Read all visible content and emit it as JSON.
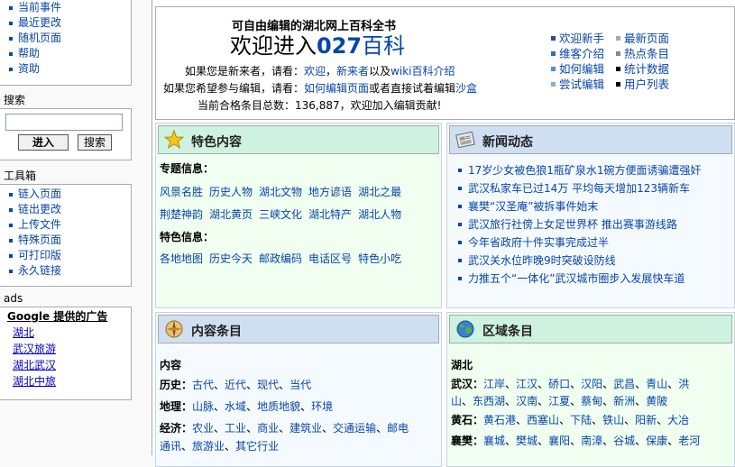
{
  "sidebar": {
    "nav_items": [
      "当前事件",
      "最近更改",
      "随机页面",
      "帮助",
      "资助"
    ],
    "search": {
      "title": "搜索",
      "go_label": "进入",
      "search_label": "搜索"
    },
    "toolbox": {
      "title": "工具箱",
      "items": [
        "链入页面",
        "链出更改",
        "上传文件",
        "特殊页面",
        "可打印版",
        "永久链接"
      ]
    },
    "ads": {
      "title": "ads",
      "provider": "Google 提供的广告",
      "links": [
        "湖北",
        "武汉旅游",
        "湖北武汉",
        "湖北中旅"
      ]
    }
  },
  "banner": {
    "tagline": "可自由编辑的湖北网上百科全书",
    "welcome_prefix": "欢迎进入",
    "welcome_num": "027",
    "welcome_suffix": "百科",
    "line1_prefix": "如果您是新来者，请看：",
    "line1_link1": "欢迎",
    "line1_mid": "，",
    "line1_link2": "新来者",
    "line1_mid2": "以及",
    "line1_link3": "wiki百科介绍",
    "line2_prefix": "如果您希望参与编辑，请看：",
    "line2_link1": "如何编辑页面",
    "line2_mid": "或者直接试着编辑",
    "line2_link2": "沙盒",
    "line3_prefix": "当前合格条目总数：",
    "line3_count": "136,887",
    "line3_suffix": "，欢迎加入编辑贡献!",
    "quick_links_col1": [
      "欢迎新手",
      "维客介绍",
      "如何编辑",
      "尝试编辑"
    ],
    "quick_links_col2": [
      "最新页面",
      "热点条目",
      "统计数据",
      "用户列表"
    ],
    "bullet_colors_col1": [
      "#334499",
      "#3366cc",
      "#5588dd",
      "#88aadd"
    ],
    "bullet_colors_col2": [
      "#aaaaaa",
      "#888888",
      "#000000",
      "#000000"
    ]
  },
  "featured": {
    "title": "特色内容",
    "topics_label": "专题信息：",
    "topics_row1": [
      "风景名胜",
      "历史人物",
      "湖北文物",
      "地方谚语",
      "湖北之最"
    ],
    "topics_row2": [
      "荆楚神韵",
      "湖北黄页",
      "三峡文化",
      "湖北特产",
      "湖北人物"
    ],
    "special_label": "特色信息：",
    "special_row": [
      "各地地图",
      "历史今天",
      "邮政编码",
      "电话区号",
      "特色小吃"
    ]
  },
  "news": {
    "title": "新闻动态",
    "items": [
      "17岁少女被色狼1瓶矿泉水1碗方便面诱骗遭强奸",
      "武汉私家车已过14万 平均每天增加123辆新车",
      "襄樊“汉圣庵”被拆事件始末",
      "武汉旅行社傍上女足世界杯 推出赛事游线路",
      "今年省政府十件实事完成过半",
      "武汉关水位昨晚9时突破设防线",
      "力推五个“一体化”武汉城市圈步入发展快车道"
    ]
  },
  "content_items": {
    "title": "内容条目",
    "section": "内容",
    "rows": [
      {
        "label": "历史：",
        "links": [
          "古代",
          "近代",
          "现代",
          "当代"
        ]
      },
      {
        "label": "地理：",
        "links": [
          "山脉",
          "水域",
          "地质地貌",
          "环境"
        ]
      },
      {
        "label": "经济：",
        "links": [
          "农业",
          "工业",
          "商业",
          "建筑业",
          "交通运输",
          "邮电"
        ]
      },
      {
        "label": "",
        "links": [
          "通讯",
          "旅游业",
          "其它行业"
        ]
      }
    ]
  },
  "regions": {
    "title": "区域条目",
    "section": "湖北",
    "rows": [
      {
        "label": "武汉：",
        "links": [
          "江岸",
          "江汉",
          "硚口",
          "汉阳",
          "武昌",
          "青山",
          "洪"
        ]
      },
      {
        "label": "",
        "links": [
          "山",
          "东西湖",
          "汉南",
          "江夏",
          "蔡甸",
          "新洲",
          "黄陂"
        ]
      },
      {
        "label": "黄石：",
        "links": [
          "黄石港",
          "西塞山",
          "下陆",
          "铁山",
          "阳新",
          "大冶"
        ]
      },
      {
        "label": "襄樊：",
        "links": [
          "襄城",
          "樊城",
          "襄阳",
          "南漳",
          "谷城",
          "保康",
          "老河"
        ]
      }
    ]
  }
}
